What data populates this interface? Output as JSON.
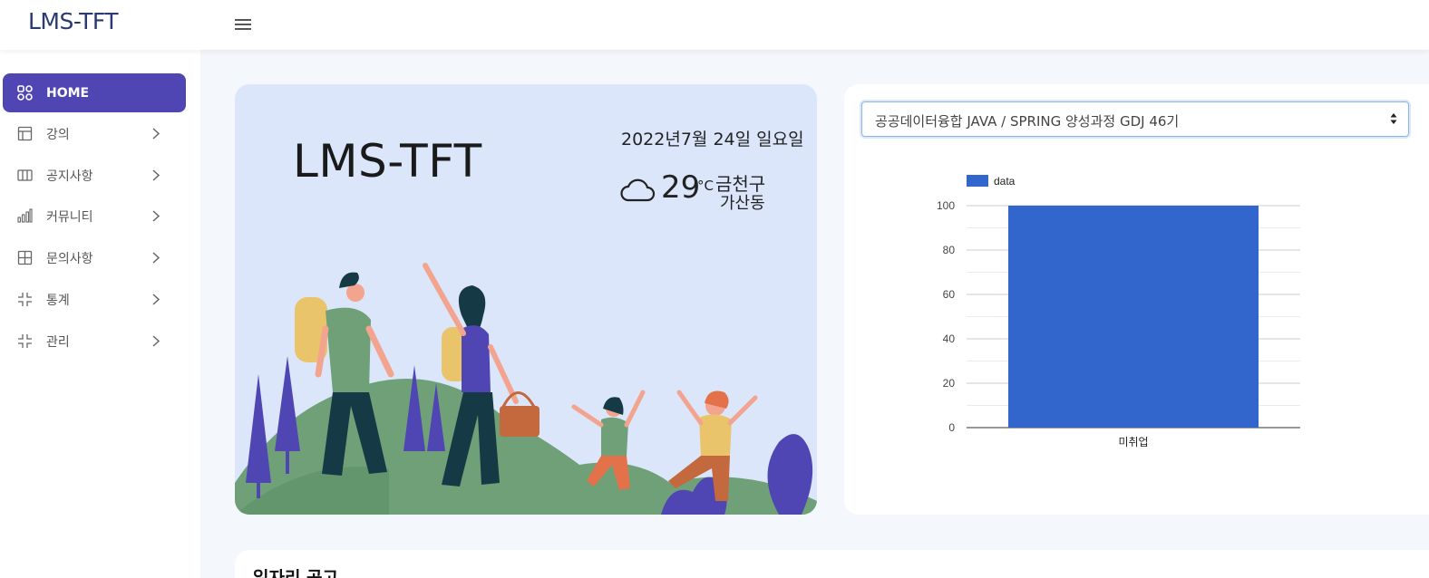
{
  "brand": "LMS-TFT",
  "sidebar": {
    "items": [
      {
        "label": "HOME",
        "icon": "grid-icon"
      },
      {
        "label": "강의",
        "icon": "layout-icon"
      },
      {
        "label": "공지사항",
        "icon": "columns-icon"
      },
      {
        "label": "커뮤니티",
        "icon": "bar-chart-icon"
      },
      {
        "label": "문의사항",
        "icon": "table-icon"
      },
      {
        "label": "통계",
        "icon": "shrink-icon"
      },
      {
        "label": "관리",
        "icon": "shrink-icon"
      }
    ]
  },
  "hero": {
    "title": "LMS-TFT",
    "date": "2022년7월 24일 일요일",
    "temperature": "29",
    "temperature_unit": "°C",
    "location_line1": "금천구",
    "location_line2": "가산동",
    "weather_icon": "cloud-icon"
  },
  "course": {
    "selected": "공공데이터융합 JAVA / SPRING 양성과정 GDJ 46기"
  },
  "chart_data": {
    "type": "bar",
    "categories": [
      "미취업"
    ],
    "series": [
      {
        "name": "data",
        "values": [
          100
        ]
      }
    ],
    "ylim": [
      0,
      100
    ],
    "yticks": [
      0,
      20,
      40,
      60,
      80,
      100
    ],
    "legend": "top-left",
    "grid": true,
    "color": "#3366cc"
  },
  "jobs": {
    "title": "일자리 공고"
  }
}
